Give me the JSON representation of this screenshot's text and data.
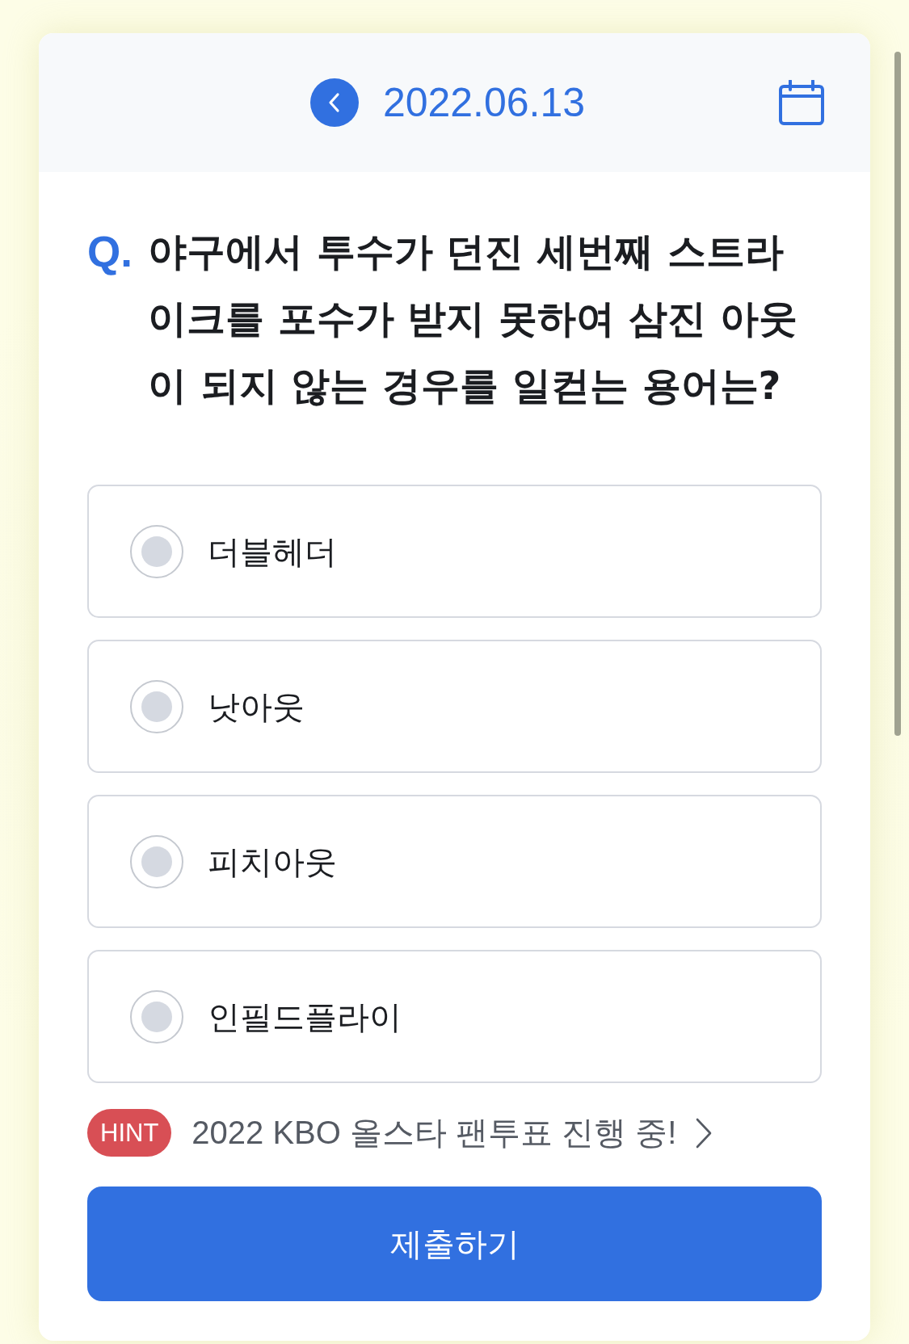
{
  "header": {
    "date": "2022.06.13"
  },
  "question": {
    "label": "Q.",
    "text": "야구에서 투수가 던진 세번째 스트라이크를 포수가 받지 못하여 삼진 아웃이 되지 않는 경우를 일컫는 용어는?"
  },
  "options": [
    {
      "text": "더블헤더",
      "selected": false
    },
    {
      "text": "낫아웃",
      "selected": false
    },
    {
      "text": "피치아웃",
      "selected": false
    },
    {
      "text": "인필드플라이",
      "selected": false
    }
  ],
  "hint": {
    "badge": "HINT",
    "text": "2022 KBO 올스타 팬투표 진행 중!"
  },
  "submit": {
    "label": "제출하기"
  }
}
